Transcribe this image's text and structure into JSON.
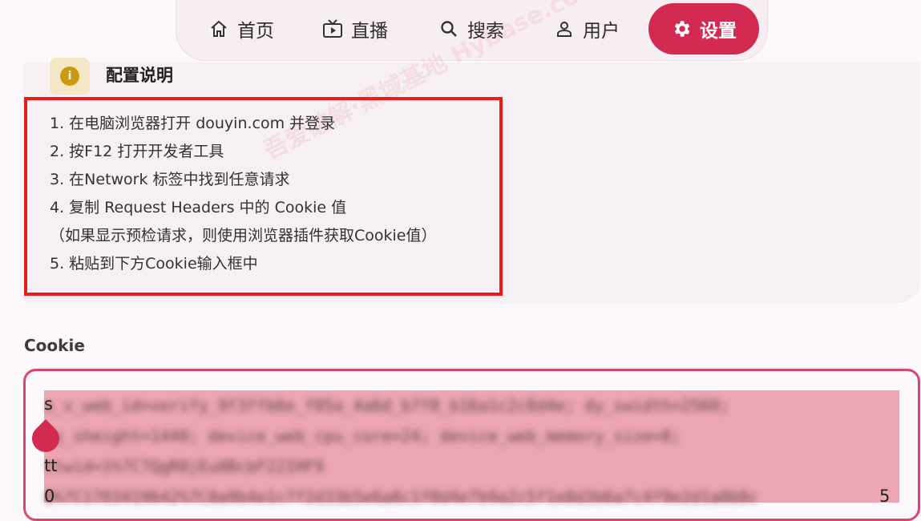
{
  "nav": {
    "items": [
      {
        "label": "首页",
        "icon": "home-icon"
      },
      {
        "label": "直播",
        "icon": "tv-icon"
      },
      {
        "label": "搜索",
        "icon": "search-icon"
      },
      {
        "label": "用户",
        "icon": "user-icon"
      },
      {
        "label": "设置",
        "icon": "gear-icon",
        "active": true
      }
    ]
  },
  "info": {
    "title": "配置说明",
    "steps": [
      "1. 在电脑浏览器打开 douyin.com 并登录",
      "2. 按F12 打开开发者工具",
      "3. 在Network 标签中找到任意请求",
      "4. 复制 Request Headers 中的 Cookie 值",
      "（如果显示预检请求，则使用浏览器插件获取Cookie值）",
      "5. 粘贴到下方Cookie输入框中"
    ],
    "watermark": "吾爱破解·黑域基地 Hybase.com"
  },
  "cookie": {
    "label": "Cookie",
    "lines": [
      "s",
      "",
      "tt",
      "0"
    ],
    "end_char": "5"
  },
  "colors": {
    "accent": "#d32a52",
    "highlight": "#ea1b1b",
    "selection": "#eca6b3"
  }
}
